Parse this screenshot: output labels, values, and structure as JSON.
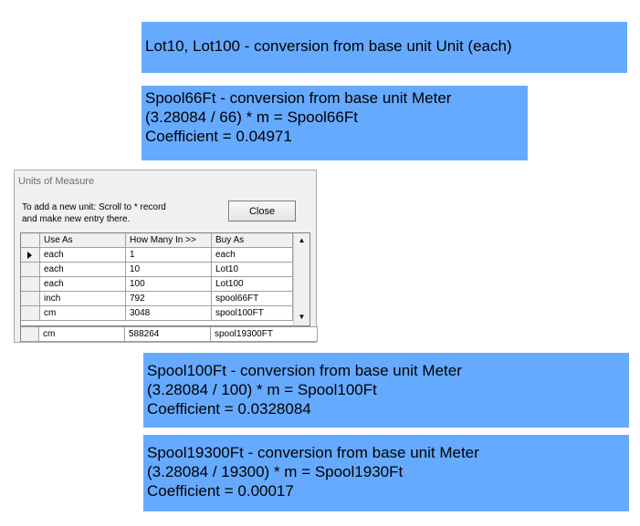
{
  "notes": [
    {
      "lines": [
        "Lot10, Lot100 - conversion from base unit Unit (each)"
      ]
    },
    {
      "lines": [
        "Spool66Ft - conversion from base unit Meter",
        "(3.28084 / 66) * m = Spool66Ft",
        "Coefficient = 0.04971"
      ]
    },
    {
      "lines": [
        "Spool100Ft - conversion from base unit Meter",
        "(3.28084 / 100) * m  = Spool100Ft",
        "Coefficient = 0.0328084"
      ]
    },
    {
      "lines": [
        "Spool19300Ft - conversion from base unit Meter",
        "(3.28084 / 19300) * m = Spool1930Ft",
        "Coefficient = 0.00017"
      ]
    }
  ],
  "dialog": {
    "title": "Units of Measure",
    "instruction_lines": [
      "To add a new unit:  Scroll to * record",
      "and make new entry there."
    ],
    "close_label": "Close",
    "columns": [
      "Use As",
      "How Many In >>",
      "Buy As"
    ],
    "rows": [
      [
        "each",
        "1",
        "each"
      ],
      [
        "each",
        "10",
        "Lot10"
      ],
      [
        "each",
        "100",
        "Lot100"
      ],
      [
        "inch",
        "792",
        "spool66FT"
      ],
      [
        "cm",
        "3048",
        "spool100FT"
      ]
    ],
    "new_row": [
      "cm",
      "588264",
      "spool19300FT"
    ],
    "scroll_up_glyph": "▲",
    "scroll_down_glyph": "▼",
    "current_row_index": 0
  }
}
